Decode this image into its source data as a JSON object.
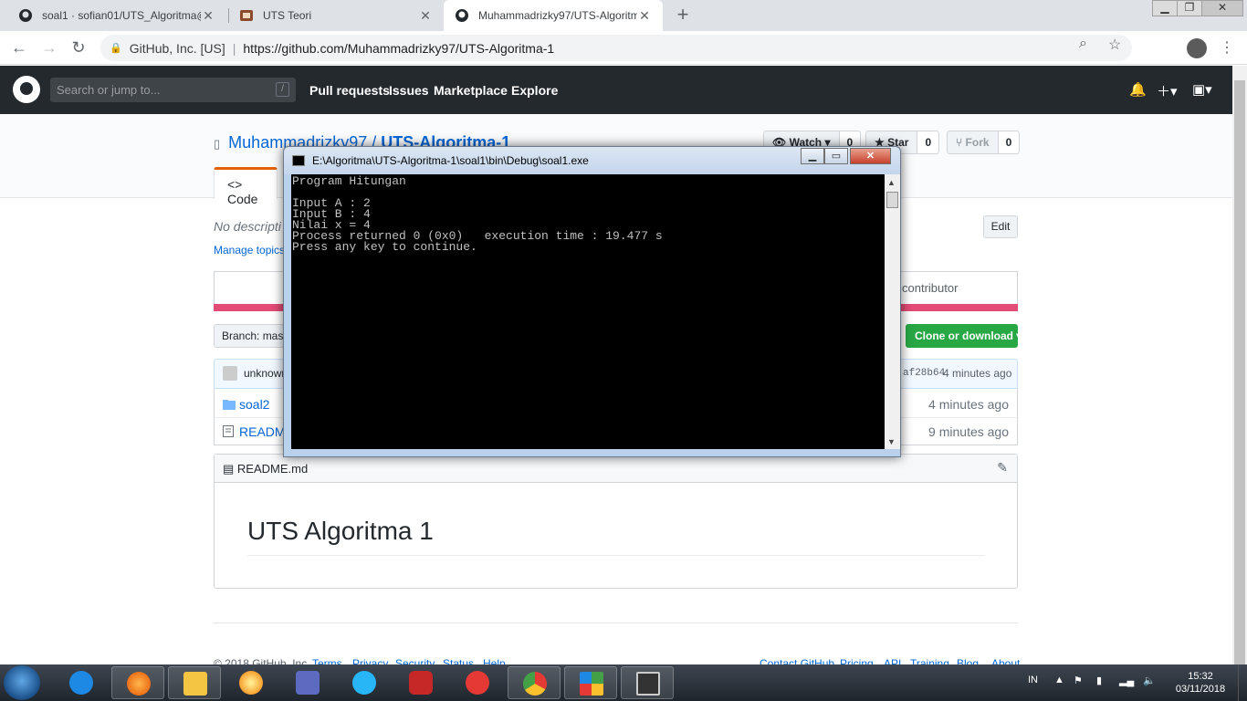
{
  "browser": {
    "tabs": [
      {
        "title": "soal1 · sofian01/UTS_Algoritma@",
        "icon": "github-icon"
      },
      {
        "title": "UTS Teori",
        "icon": "page-icon"
      },
      {
        "title": "Muhammadrizky97/UTS-Algoritm",
        "icon": "github-icon",
        "active": true
      }
    ],
    "site_label": "GitHub, Inc. [US]",
    "url": "https://github.com/Muhammadrizky97/UTS-Algoritma-1"
  },
  "github": {
    "search_placeholder": "Search or jump to...",
    "search_key": "/",
    "nav": [
      "Pull requests",
      "Issues",
      "Marketplace",
      "Explore"
    ],
    "repo_owner": "Muhammadrizky97",
    "repo_sep": "/",
    "repo_name": "UTS-Algoritma-1",
    "watch": {
      "label": "Watch ▾",
      "count": "0"
    },
    "star": {
      "label": "Star",
      "count": "0"
    },
    "fork": {
      "label": "Fork",
      "count": "0"
    },
    "code_tab": "Code",
    "description": "No descripti",
    "manage_topics": "Manage topics",
    "edit": "Edit",
    "contributors": "contributor",
    "branch": "Branch: maste",
    "clone_button": "Clone or download ▾",
    "commit_user": "unknown",
    "commit_hash": "af28b64",
    "commit_age": "4 minutes ago",
    "files": [
      {
        "name": "soal2",
        "type": "folder",
        "age": "4 minutes ago"
      },
      {
        "name": "README",
        "type": "file",
        "age": "9 minutes ago"
      }
    ],
    "readme_file": "README.md",
    "readme_heading": "UTS Algoritma 1",
    "footer_left": [
      "© 2018 GitHub, Inc.",
      "Terms",
      "Privacy",
      "Security",
      "Status",
      "Help"
    ],
    "footer_right": [
      "Contact GitHub",
      "Pricing",
      "API",
      "Training",
      "Blog",
      "About"
    ]
  },
  "console": {
    "title": "E:\\Algoritma\\UTS-Algoritma-1\\soal1\\bin\\Debug\\soal1.exe",
    "lines": [
      "Program Hitungan",
      "",
      "Input A : 2",
      "Input B : 4",
      "Nilai x = 4",
      "Process returned 0 (0x0)   execution time : 19.477 s",
      "Press any key to continue."
    ]
  },
  "taskbar": {
    "language": "IN",
    "time": "15:32",
    "date": "03/11/2018"
  },
  "colors": {
    "gh_header": "#24292e",
    "link": "#0366d6",
    "clone_green": "#28a745",
    "lang_bar": "#e34c76",
    "code_tab_accent": "#e36209"
  }
}
